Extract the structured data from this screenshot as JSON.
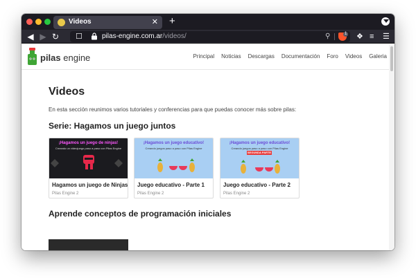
{
  "browser": {
    "tab": {
      "title": "Videos"
    },
    "url": {
      "host": "pilas-engine.com.ar",
      "path": "/videos/"
    },
    "extension_badge": "1"
  },
  "site": {
    "logo": {
      "prefix": "pilas",
      "suffix": "engine"
    },
    "nav": [
      "Principal",
      "Noticias",
      "Descargas",
      "Documentación",
      "Foro",
      "Videos",
      "Galeria"
    ]
  },
  "page": {
    "title": "Videos",
    "intro": "En esta sección reunimos varios tutoriales y conferencias para que puedas conocer más sobre pilas:",
    "sections": [
      {
        "title": "Serie: Hagamos un juego juntos",
        "cards": [
          {
            "title": "Hagamos un juego de Ninjas",
            "meta": "Pilas Engine 2",
            "thumb_title": "¡Hagamos un juego de ninjas!",
            "thumb_sub": "Creando un videojuego paso a paso con Pilas Engine"
          },
          {
            "title": "Juego educativo - Parte 1",
            "meta": "Pilas Engine 2",
            "thumb_title": "¡Hagamos un juego educativo!",
            "thumb_sub": "Creando juegos paso a paso con Pilas Engine"
          },
          {
            "title": "Juego educativo - Parte 2",
            "meta": "Pilas Engine 2",
            "thumb_title": "¡Hagamos un juego educativo!",
            "thumb_sub": "Creando juegos paso a paso con Pilas Engine",
            "thumb_ribbon": "SEGUNDA PARTE"
          }
        ]
      },
      {
        "title": "Aprende conceptos de programación iniciales"
      }
    ]
  },
  "colors": {
    "chrome_dark": "#1c1b22",
    "toolbar": "#2b2a33",
    "accent_red": "#e83a3a",
    "logo_green": "#3fa535",
    "thumb_purple": "#6a4bd6"
  },
  "icons": [
    "back-icon",
    "forward-icon",
    "reload-icon",
    "bookmark-icon",
    "lock-icon",
    "zoom-icon",
    "shield-icon",
    "puzzle-icon",
    "playlist-icon",
    "menu-icon"
  ]
}
